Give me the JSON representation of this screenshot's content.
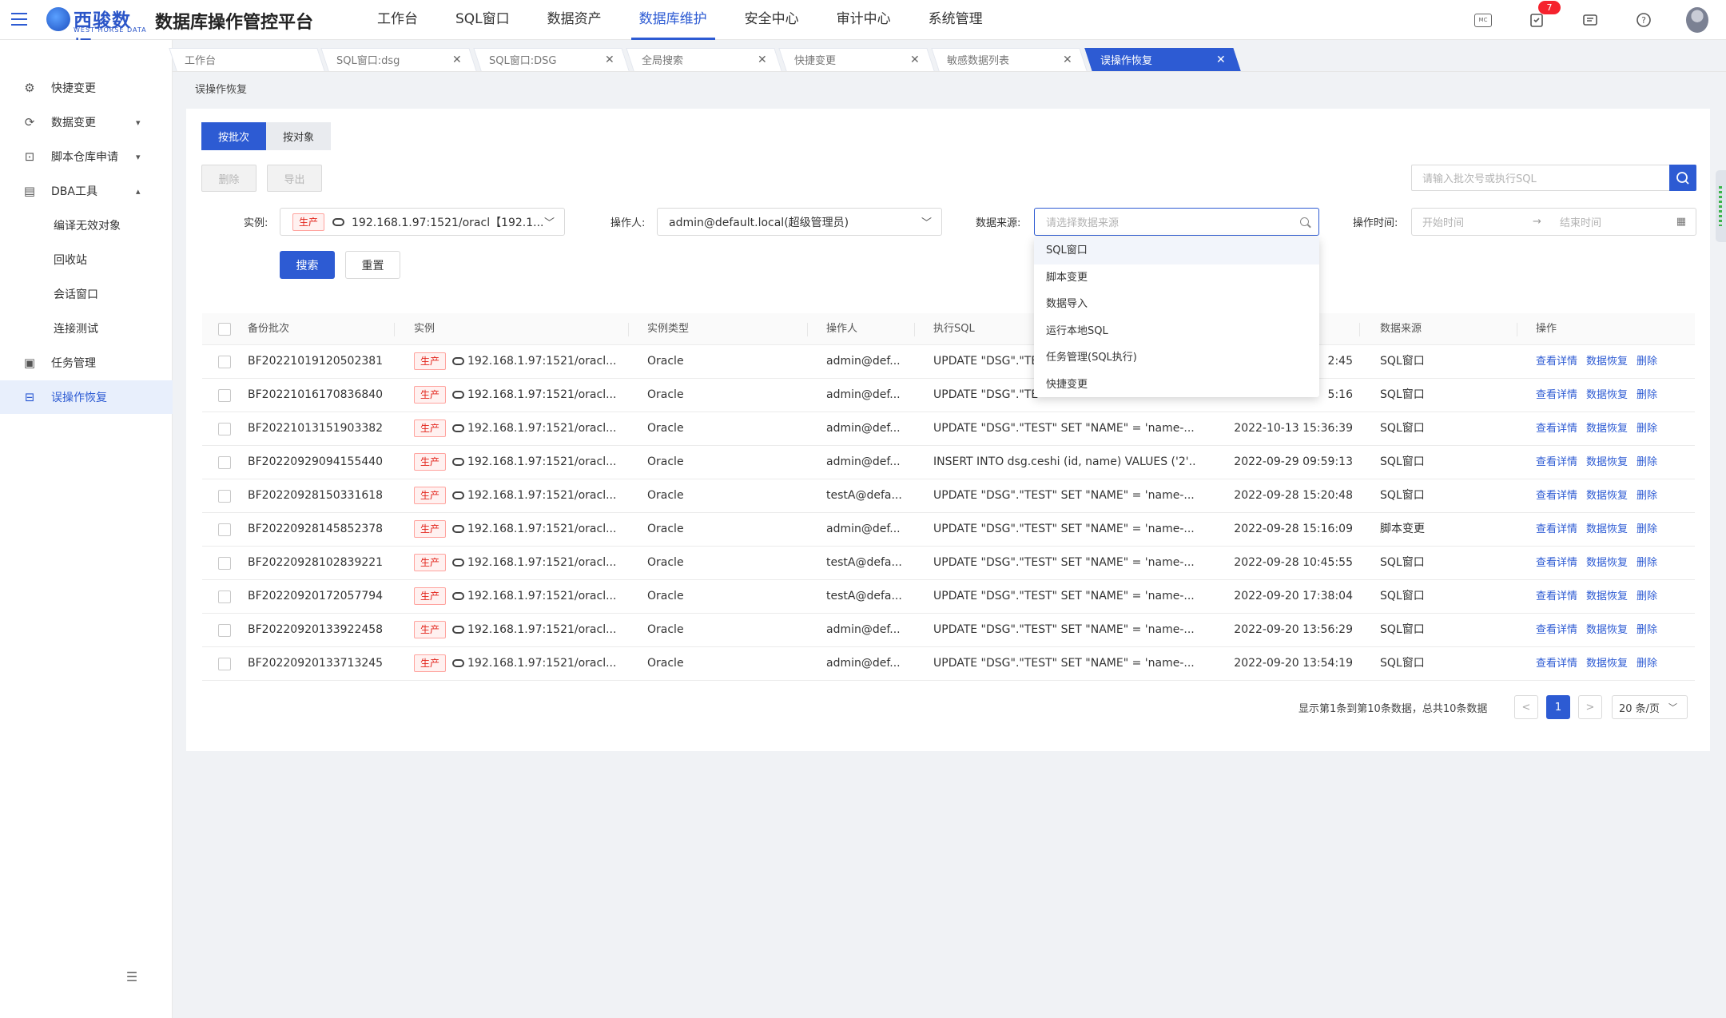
{
  "header": {
    "logo_name": "西骏数据",
    "logo_sub": "WEST HORSE DATA",
    "platform_title": "数据库操作管控平台",
    "nav": [
      "工作台",
      "SQL窗口",
      "数据资产",
      "数据库维护",
      "安全中心",
      "审计中心",
      "系统管理"
    ],
    "active_nav": "数据库维护",
    "mc_label": "MC",
    "notification_count": "7"
  },
  "sidebar": {
    "items": [
      {
        "label": "快捷变更"
      },
      {
        "label": "数据变更"
      },
      {
        "label": "脚本仓库申请"
      },
      {
        "label": "DBA工具"
      },
      {
        "label": "编译无效对象"
      },
      {
        "label": "回收站"
      },
      {
        "label": "会话窗口"
      },
      {
        "label": "连接测试"
      },
      {
        "label": "任务管理"
      },
      {
        "label": "误操作恢复"
      }
    ]
  },
  "tabs": [
    "工作台",
    "SQL窗口:dsg",
    "SQL窗口:DSG",
    "全局搜索",
    "快捷变更",
    "敏感数据列表",
    "误操作恢复"
  ],
  "breadcrumb": "误操作恢复",
  "toolbar": {
    "mode_batch": "按批次",
    "mode_object": "按对象",
    "delete": "删除",
    "export": "导出",
    "search_placeholder": "请输入批次号或执行SQL"
  },
  "filters": {
    "instance_label": "实例:",
    "instance_tag": "生产",
    "instance_value": "192.168.1.97:1521/oracl【192.1...",
    "operator_label": "操作人:",
    "operator_value": "admin@default.local(超级管理员)",
    "source_label": "数据来源:",
    "source_placeholder": "请选择数据来源",
    "time_label": "操作时间:",
    "time_start": "开始时间",
    "time_end": "结束时间",
    "search_btn": "搜索",
    "reset_btn": "重置"
  },
  "source_dropdown": [
    "SQL窗口",
    "脚本变更",
    "数据导入",
    "运行本地SQL",
    "任务管理(SQL执行)",
    "快捷变更"
  ],
  "table": {
    "columns": [
      "备份批次",
      "实例",
      "实例类型",
      "操作人",
      "执行SQL",
      "数据来源",
      "操作"
    ],
    "actions": [
      "查看详情",
      "数据恢复",
      "删除"
    ],
    "rows": [
      {
        "batch": "BF20221019120502381",
        "tag": "生产",
        "instance": "192.168.1.97:1521/oracl...",
        "type": "Oracle",
        "operator": "admin@def...",
        "sql": "UPDATE \"DSG\".\"TE",
        "time": "2:45",
        "source": "SQL窗口"
      },
      {
        "batch": "BF20221016170836840",
        "tag": "生产",
        "instance": "192.168.1.97:1521/oracl...",
        "type": "Oracle",
        "operator": "admin@def...",
        "sql": "UPDATE \"DSG\".\"TE",
        "time": "5:16",
        "source": "SQL窗口"
      },
      {
        "batch": "BF20221013151903382",
        "tag": "生产",
        "instance": "192.168.1.97:1521/oracl...",
        "type": "Oracle",
        "operator": "admin@def...",
        "sql": "UPDATE \"DSG\".\"TEST\" SET \"NAME\" = 'name-...",
        "time": "2022-10-13 15:36:39",
        "source": "SQL窗口"
      },
      {
        "batch": "BF20220929094155440",
        "tag": "生产",
        "instance": "192.168.1.97:1521/oracl...",
        "type": "Oracle",
        "operator": "admin@def...",
        "sql": "INSERT INTO dsg.ceshi (id, name) VALUES ('2'...",
        "time": "2022-09-29 09:59:13",
        "source": "SQL窗口"
      },
      {
        "batch": "BF20220928150331618",
        "tag": "生产",
        "instance": "192.168.1.97:1521/oracl...",
        "type": "Oracle",
        "operator": "testA@defa...",
        "sql": "UPDATE \"DSG\".\"TEST\" SET \"NAME\" = 'name-...",
        "time": "2022-09-28 15:20:48",
        "source": "SQL窗口"
      },
      {
        "batch": "BF20220928145852378",
        "tag": "生产",
        "instance": "192.168.1.97:1521/oracl...",
        "type": "Oracle",
        "operator": "admin@def...",
        "sql": "UPDATE \"DSG\".\"TEST\" SET \"NAME\" = 'name-...",
        "time": "2022-09-28 15:16:09",
        "source": "脚本变更"
      },
      {
        "batch": "BF20220928102839221",
        "tag": "生产",
        "instance": "192.168.1.97:1521/oracl...",
        "type": "Oracle",
        "operator": "testA@defa...",
        "sql": "UPDATE \"DSG\".\"TEST\" SET \"NAME\" = 'name-...",
        "time": "2022-09-28 10:45:55",
        "source": "SQL窗口"
      },
      {
        "batch": "BF20220920172057794",
        "tag": "生产",
        "instance": "192.168.1.97:1521/oracl...",
        "type": "Oracle",
        "operator": "testA@defa...",
        "sql": "UPDATE \"DSG\".\"TEST\" SET \"NAME\" = 'name-...",
        "time": "2022-09-20 17:38:04",
        "source": "SQL窗口"
      },
      {
        "batch": "BF20220920133922458",
        "tag": "生产",
        "instance": "192.168.1.97:1521/oracl...",
        "type": "Oracle",
        "operator": "admin@def...",
        "sql": "UPDATE \"DSG\".\"TEST\" SET \"NAME\" = 'name-...",
        "time": "2022-09-20 13:56:29",
        "source": "SQL窗口"
      },
      {
        "batch": "BF20220920133713245",
        "tag": "生产",
        "instance": "192.168.1.97:1521/oracl...",
        "type": "Oracle",
        "operator": "admin@def...",
        "sql": "UPDATE \"DSG\".\"TEST\" SET \"NAME\" = 'name-...",
        "time": "2022-09-20 13:54:19",
        "source": "SQL窗口"
      }
    ]
  },
  "pagination": {
    "info": "显示第1条到第10条数据，总共10条数据",
    "prev": "<",
    "current": "1",
    "next": ">",
    "page_size": "20 条/页"
  },
  "colors": {
    "primary": "#2d5bd3",
    "danger": "#e2231a",
    "badge": "#f5222d"
  }
}
